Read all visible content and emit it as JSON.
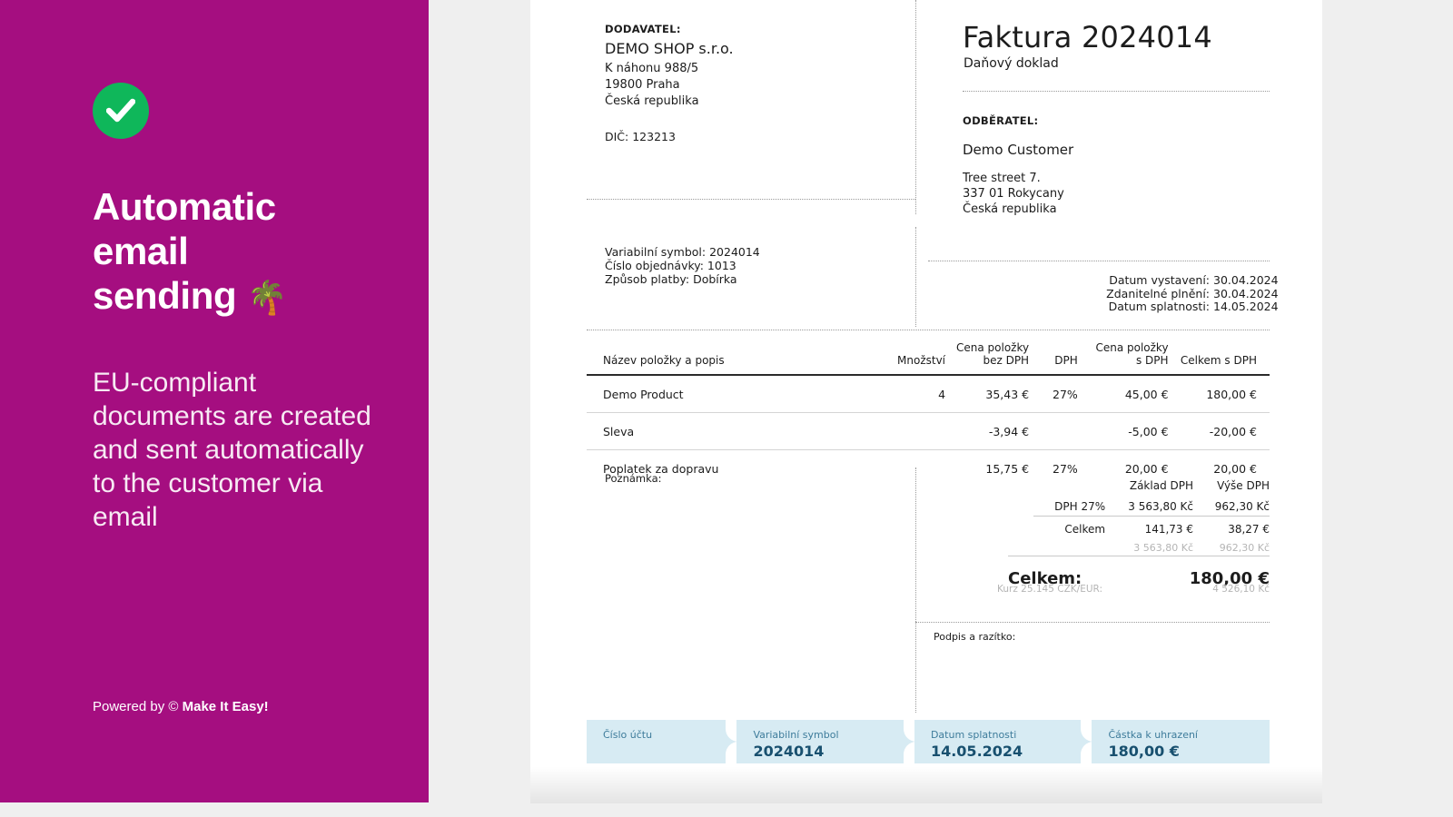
{
  "promo": {
    "badge_icon": "checkmark-circle-icon",
    "heading_line1": "Automatic",
    "heading_line2": "email",
    "heading_line3": "sending",
    "heading_emoji": "🌴",
    "body": "EU-compliant documents are created and sent automatically to the customer via email",
    "footer_prefix": "Powered by ©",
    "footer_brand": "Make It Easy!"
  },
  "invoice": {
    "supplier": {
      "label": "DODAVATEL:",
      "company": "DEMO SHOP s.r.o.",
      "street": "K náhonu 988/5",
      "city": "19800 Praha",
      "country": "Česká republika",
      "tax_id": "DIČ: 123213"
    },
    "title": "Faktura 2024014",
    "subtitle": "Daňový doklad",
    "customer": {
      "label": "ODBĚRATEL:",
      "name": "Demo Customer",
      "street": "Tree street 7.",
      "city": "337 01 Rokycany",
      "country": "Česká republika"
    },
    "payment_meta": {
      "variable_symbol": "Variabilní symbol: 2024014",
      "order_number": "Číslo objednávky: 1013",
      "payment_method": "Způsob platby: Dobírka"
    },
    "dates": {
      "issue_label": "Datum vystavení:",
      "issue_value": "30.04.2024",
      "taxable_label": "Zdanitelné plnění:",
      "taxable_value": "30.04.2024",
      "due_label": "Datum splatnosti:",
      "due_value": "14.05.2024"
    },
    "table": {
      "headers": {
        "name": "Název položky a popis",
        "qty": "Množství",
        "unit_net_l1": "Cena položky",
        "unit_net_l2": "bez DPH",
        "vat": "DPH",
        "unit_gross_l1": "Cena položky",
        "unit_gross_l2": "s DPH",
        "total": "Celkem s DPH"
      },
      "rows": [
        {
          "name": "Demo Product",
          "qty": "4",
          "unit_net": "35,43 €",
          "vat": "27%",
          "unit_gross": "45,00 €",
          "total": "180,00 €"
        },
        {
          "name": "Sleva",
          "qty": "",
          "unit_net": "-3,94 €",
          "vat": "",
          "unit_gross": "-5,00 €",
          "total": "-20,00 €"
        },
        {
          "name": "Poplatek za dopravu",
          "qty": "",
          "unit_net": "15,75 €",
          "vat": "27%",
          "unit_gross": "20,00 €",
          "total": "20,00 €"
        }
      ]
    },
    "note_label": "Poznámka:",
    "vat_summary": {
      "col_base": "Základ DPH",
      "col_amount": "Výše DPH",
      "rate_label": "DPH 27%",
      "rate_base": "3 563,80 Kč",
      "rate_amount": "962,30 Kč",
      "total_label": "Celkem",
      "total_base": "141,73 €",
      "total_amount": "38,27 €",
      "czk_base": "3 563,80 Kč",
      "czk_amount": "962,30 Kč"
    },
    "grand_total": {
      "label": "Celkem:",
      "value": "180,00 €",
      "fx_label": "Kurz 25.145 CZK/EUR:",
      "fx_value": "4 526,10 Kč"
    },
    "signature_label": "Podpis a razítko:",
    "footer_chips": [
      {
        "title": "Číslo účtu",
        "value": ""
      },
      {
        "title": "Variabilní symbol",
        "value": "2024014"
      },
      {
        "title": "Datum splatnosti",
        "value": "14.05.2024"
      },
      {
        "title": "Částka k uhrazení",
        "value": "180,00 €"
      }
    ]
  },
  "colors": {
    "promo_bg": "#A50E80",
    "badge_green": "#0FB75A",
    "chip_bg": "#D7EBF3",
    "chip_text": "#18506F",
    "page_bg": "#EFEFEF"
  }
}
